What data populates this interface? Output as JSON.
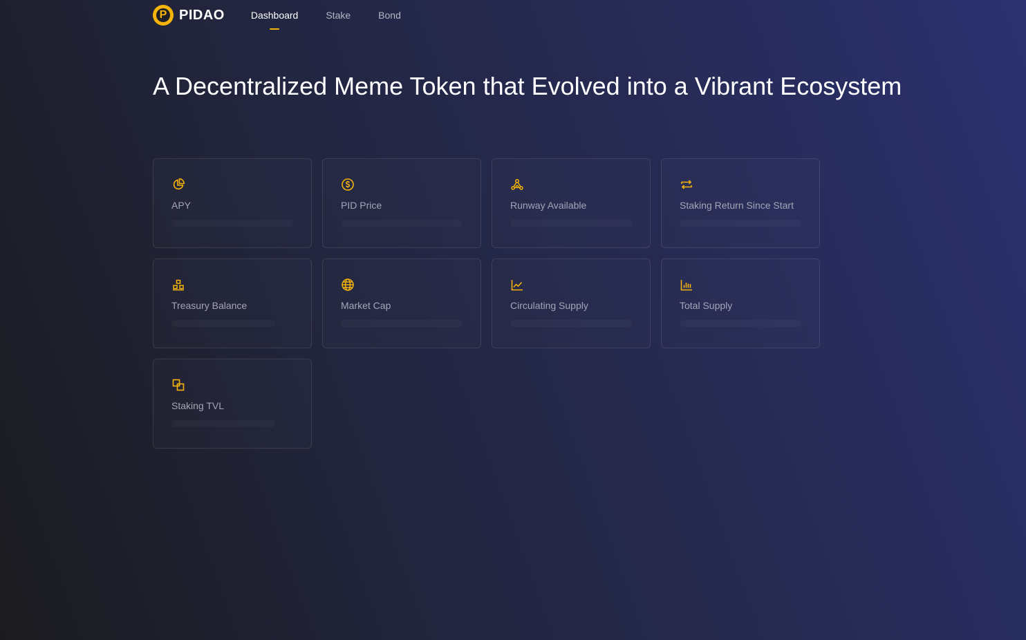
{
  "brand": {
    "name": "PIDAO",
    "logo_letter": "P"
  },
  "nav": {
    "links": [
      {
        "label": "Dashboard",
        "active": true
      },
      {
        "label": "Stake",
        "active": false
      },
      {
        "label": "Bond",
        "active": false
      }
    ]
  },
  "hero": {
    "title": "A Decentralized Meme Token that Evolved into a Vibrant Ecosystem"
  },
  "cards": [
    {
      "label": "APY",
      "icon": "pie-chart-icon"
    },
    {
      "label": "PID Price",
      "icon": "dollar-coin-icon"
    },
    {
      "label": "Runway Available",
      "icon": "network-nodes-icon"
    },
    {
      "label": "Staking Return Since Start",
      "icon": "repeat-icon"
    },
    {
      "label": "Treasury Balance",
      "icon": "stacked-blocks-icon"
    },
    {
      "label": "Market Cap",
      "icon": "globe-icon"
    },
    {
      "label": "Circulating Supply",
      "icon": "line-chart-icon"
    },
    {
      "label": "Total Supply",
      "icon": "bar-chart-icon"
    },
    {
      "label": "Staking TVL",
      "icon": "overlap-squares-icon"
    }
  ],
  "colors": {
    "accent": "#f5b40a",
    "label": "#a3a6b7",
    "nav_inactive": "#b4b6c6"
  }
}
